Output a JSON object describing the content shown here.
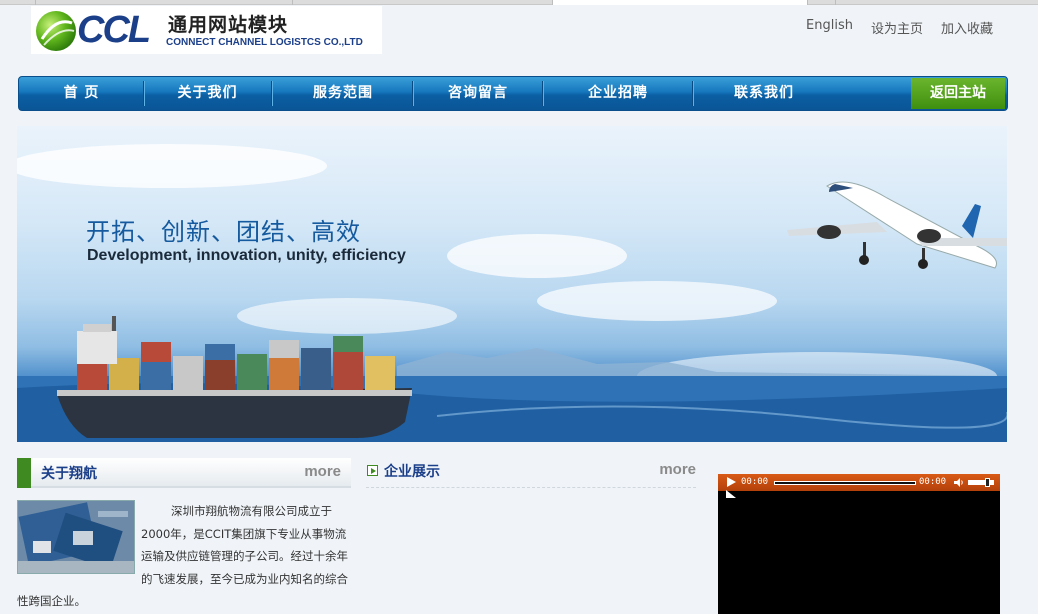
{
  "header": {
    "logo_text": "CCL",
    "logo_cn": "通用网站模块",
    "logo_en": "CONNECT CHANNEL LOGISTCS CO.,LTD",
    "links": [
      "English",
      "设为主页",
      "加入收藏"
    ]
  },
  "nav": {
    "items": [
      "首  页",
      "关于我们",
      "服务范围",
      "咨询留言",
      "企业招聘",
      "联系我们"
    ],
    "return_label": "返回主站"
  },
  "banner": {
    "title": "开拓、创新、团结、高效",
    "subtitle": "Development, innovation, unity, efficiency"
  },
  "about": {
    "title": "关于翔航",
    "more": "more",
    "text": "深圳市翔航物流有限公司成立于2000年，是CCIT集团旗下专业从事物流运输及供应链管理的子公司。经过十余年的飞速发展，至今已成为业内知名的综合性跨国企业。"
  },
  "showcase": {
    "title": "企业展示",
    "more": "more"
  },
  "player": {
    "time_current": "00:00",
    "time_total": "00:00",
    "progress": 0,
    "volume": 0.8
  },
  "colors": {
    "nav_blue": "#1677bd",
    "return_green": "#4f9f1a",
    "heading_blue": "#1c3f8a",
    "player_orange": "#d95a16"
  }
}
